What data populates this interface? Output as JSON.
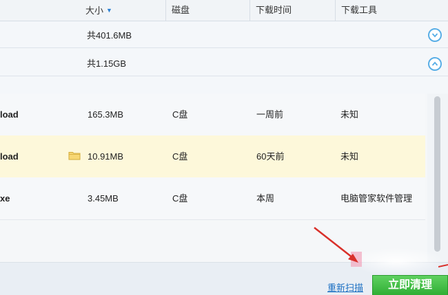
{
  "header": {
    "columns": [
      "大小",
      "磁盘",
      "下载时间",
      "下载工具"
    ]
  },
  "groups": [
    {
      "total": "共401.6MB",
      "toggle": "expand"
    },
    {
      "total": "共1.15GB",
      "toggle": "collapse"
    }
  ],
  "rows": [
    {
      "name": "load",
      "size": "165.3MB",
      "disk": "C盘",
      "time": "一周前",
      "tool": "未知",
      "selected": false
    },
    {
      "name": "load",
      "size": "10.91MB",
      "disk": "C盘",
      "time": "60天前",
      "tool": "未知",
      "selected": true
    },
    {
      "name": "xe",
      "size": "3.45MB",
      "disk": "C盘",
      "time": "本周",
      "tool": "电脑管家软件管理",
      "selected": false
    }
  ],
  "footer": {
    "rescan_label": "重新扫描",
    "clean_label": "立即清理"
  },
  "colors": {
    "accent": "#2a7fd3",
    "selected_row": "#fdf8da",
    "clean_button": "#36b43b",
    "annotation": "#d9302a"
  }
}
